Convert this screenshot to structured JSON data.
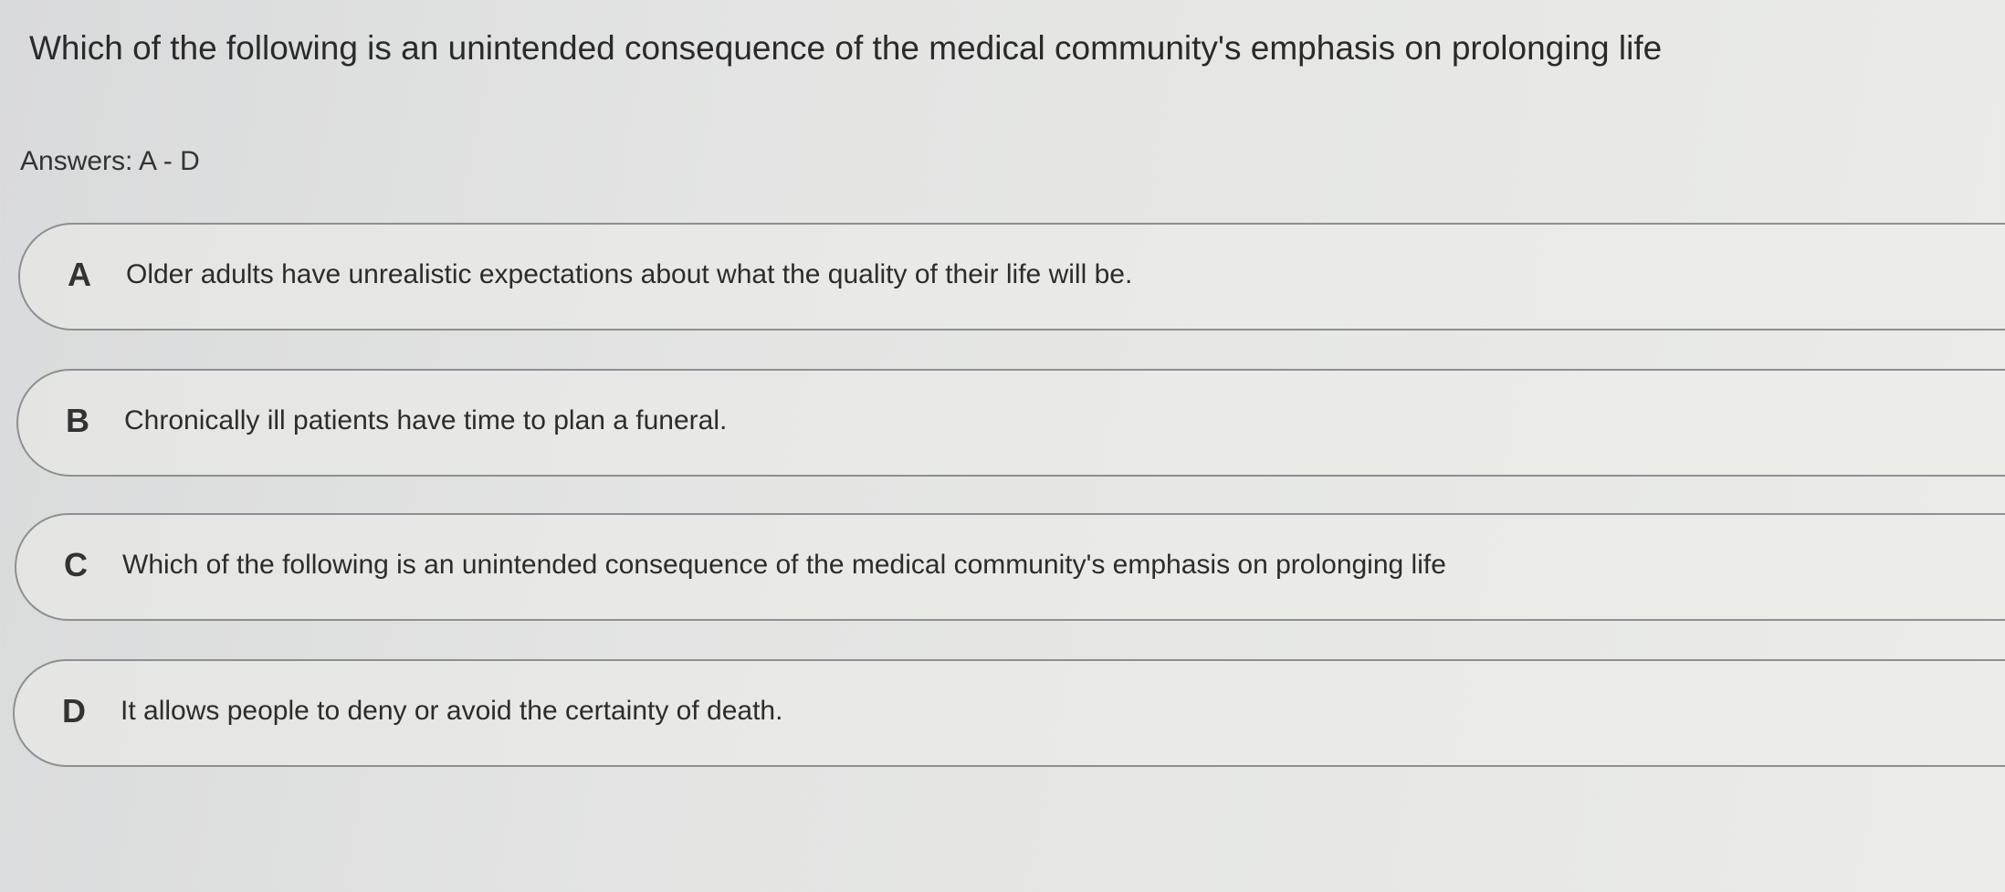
{
  "question": {
    "text": "Which of the following is an unintended consequence of the medical community's emphasis on prolonging life"
  },
  "answers_label": "Answers: A - D",
  "options": [
    {
      "letter": "A",
      "text": "Older adults have unrealistic expectations about what the quality of their life will be."
    },
    {
      "letter": "B",
      "text": "Chronically ill patients have time to plan a funeral."
    },
    {
      "letter": "C",
      "text": "Which of the following is an unintended consequence of the medical community's emphasis on prolonging life"
    },
    {
      "letter": "D",
      "text": "It allows people to deny or avoid the certainty of death."
    }
  ],
  "colors": {
    "option_border": "#8e8f90",
    "text": "#2b2b2b",
    "background": "#e4e5e3"
  }
}
